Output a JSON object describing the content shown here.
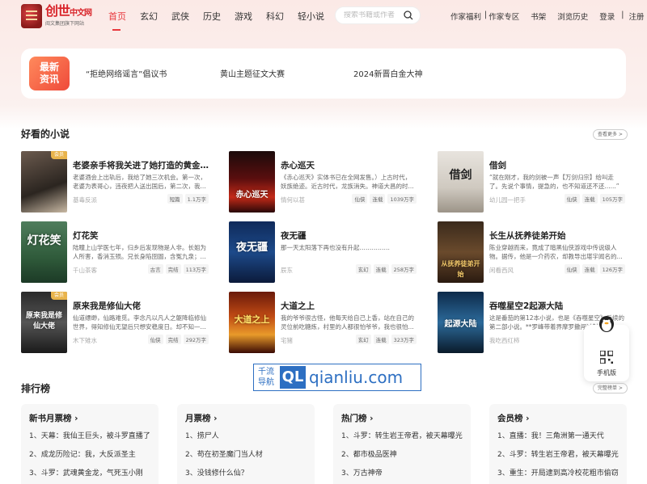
{
  "header": {
    "logo_main": "创世",
    "logo_small": "中文网",
    "logo_sub": "阅文集团旗下网站",
    "nav": [
      "首页",
      "玄幻",
      "武侠",
      "历史",
      "游戏",
      "科幻",
      "轻小说"
    ],
    "search_placeholder": "搜索书籍或作者",
    "links": [
      "作家福利",
      "|",
      "作家专区",
      "书架",
      "浏览历史",
      "登录",
      "|",
      "注册"
    ]
  },
  "news": {
    "badge": "最新\n资讯",
    "badge_line1": "最新",
    "badge_line2": "资讯",
    "items": [
      "“拒绝网络谣言”倡议书",
      "黄山主题征文大赛",
      "2024新晋白金大神"
    ]
  },
  "good_books": {
    "title": "好看的小说",
    "more": "查看更多 >",
    "books": [
      {
        "title": "老婆亲手将我关进了她打造的黄金笼...",
        "desc": "老婆酒会上出轨后，我给了她三次机会。第一次，老婆为表哥心，违夜把人送出国后，第二次，我...",
        "author": "基毒反派",
        "tags": [
          "短篇",
          "1.1万字"
        ],
        "vip": "会员",
        "cover_text": ""
      },
      {
        "title": "赤心巡天",
        "desc": "《赤心巡天》实体书已在全网发售。）上古时代，妖族绝迹。近古时代，龙族消失。神道大昌的时...",
        "author": "情何以甚",
        "tags": [
          "仙侠",
          "连载",
          "1039万字"
        ],
        "vip": "",
        "cover_text": "赤心巡天"
      },
      {
        "title": "借剑",
        "desc": "“就在刚才，我的剑被一声【万剑归宗】给叫走了。先说个事情，提急的，也不知道还不还......”",
        "author": "幼儿园一把手",
        "tags": [
          "仙侠",
          "连载",
          "105万字"
        ],
        "vip": "",
        "cover_text": "借剑"
      },
      {
        "title": "灯花笑",
        "desc": "陆瞳上山学医七年，归乡后发现物是人非。长姐为人所害，香消玉殒。兄长身陷囹圄，含冤九泉；...",
        "author": "千山茶客",
        "tags": [
          "古言",
          "完结",
          "113万字"
        ],
        "vip": "",
        "cover_text": "灯花笑"
      },
      {
        "title": "夜无疆",
        "desc": "那一天太阳落下再也没有升起……………",
        "author": "辰东",
        "tags": [
          "玄幻",
          "连载",
          "258万字"
        ],
        "vip": "",
        "cover_text": "夜无疆"
      },
      {
        "title": "长生从抚养徒弟开始",
        "desc": "陈业穿越而来，竟成了暗黑仙侠游戏中传说级人物。据传，他是一介药农，却教导出堪宇闻名的...",
        "author": "闲看西风",
        "tags": [
          "仙侠",
          "连载",
          "126万字"
        ],
        "vip": "",
        "cover_text": "从抚养徒弟开始"
      },
      {
        "title": "原来我是修仙大佬",
        "desc": "仙道缥缈，仙路难觅。李念凡以凡人之躯降临修仙世界，得知修仙无望后只想安稳度日。却不知—...",
        "author": "木下雉水",
        "tags": [
          "仙侠",
          "完结",
          "292万字"
        ],
        "vip": "会员",
        "cover_text": "原来我是修仙大佬"
      },
      {
        "title": "大道之上",
        "desc": "我的爷爷很古怪，他每天给自己上香，站在自己的灵位前吃糖炼，村里的人都很怕爷爷，我也很怕...",
        "author": "宅猪",
        "tags": [
          "玄幻",
          "连载",
          "323万字"
        ],
        "vip": "",
        "cover_text": "大道之上"
      },
      {
        "title": "吞噬星空2起源大陆",
        "desc": "这是番茄的第12本小说，也是《吞噬星空》后续的第二部小说。**罗峰带着界摩罗撒闯过封印...",
        "author": "我吃西红柿",
        "tags": [
          "科幻",
          "连载",
          ""
        ],
        "vip": "",
        "cover_text": "起源大陆"
      }
    ]
  },
  "ranking": {
    "title": "排行榜",
    "more": "完整榜单 >",
    "boards": [
      {
        "name": "新书月票榜 ›",
        "items": [
          "1、天幕：我仙王巨头，被斗罗直播了",
          "2、成龙历险记：我，大反派圣主",
          "3、斗罗：武魂黄金龙，气死玉小刚"
        ]
      },
      {
        "name": "月票榜 ›",
        "items": [
          "1、捞尸人",
          "2、苟在初圣魔门当人材",
          "3、没钱修什么仙？"
        ]
      },
      {
        "name": "热门榜 ›",
        "items": [
          "1、斗罗：转生岩王帝君，被天幕曝光",
          "2、都市极品医神",
          "3、万古神帝"
        ]
      },
      {
        "name": "会员榜 ›",
        "items": [
          "1、直播：我！三角洲第一通天代",
          "2、斗罗：转生岩王帝君，被天幕曝光",
          "3、重生：开局逮到高冷校花粗市偷窃"
        ]
      }
    ]
  },
  "side": {
    "label": "手机版"
  },
  "watermark": {
    "left": "千流\n导航",
    "left1": "千流",
    "left2": "导航",
    "ql": "QL",
    "domain": "qianliu.com"
  },
  "colors": {
    "accent": "#e8383d",
    "badge_start": "#ff8a5c",
    "badge_end": "#ef4a3a",
    "watermark": "#2d6fc2"
  }
}
